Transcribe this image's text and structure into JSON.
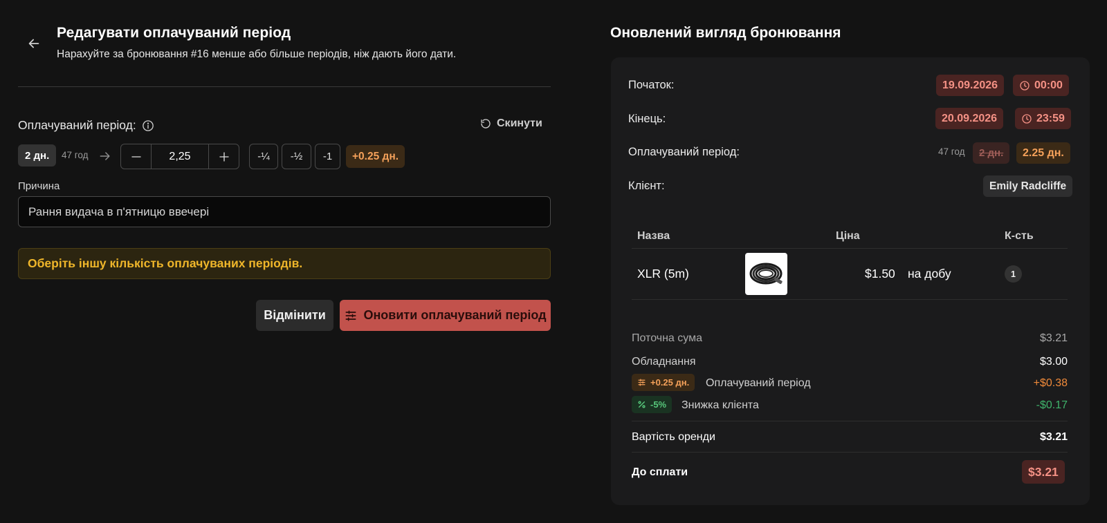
{
  "header": {
    "title": "Редагувати оплачуваний період",
    "subtitle": "Нарахуйте за бронювання #16 менше або більше періодів, ніж дають його дати."
  },
  "period": {
    "label": "Оплачуваний період:",
    "reset_label": "Скинути",
    "current_days": "2 дн.",
    "current_hours": "47 год",
    "stepper_value": "2,25",
    "quick": [
      "-¼",
      "-½",
      "-1"
    ],
    "delta_badge": "+0.25 дн."
  },
  "reason": {
    "label": "Причина",
    "value": "Рання видача в п'ятницю ввечері"
  },
  "warning": "Оберіть іншу кількість оплачуваних періодів.",
  "actions": {
    "cancel": "Відмінити",
    "update": "Оновити оплачуваний період"
  },
  "preview": {
    "title": "Оновлений вигляд бронювання",
    "start_label": "Початок:",
    "start_date": "19.09.2026",
    "start_time": "00:00",
    "end_label": "Кінець:",
    "end_date": "20.09.2026",
    "end_time": "23:59",
    "bp_label": "Оплачуваний період:",
    "bp_hours": "47 год",
    "bp_old": "2 дн.",
    "bp_new": "2.25 дн.",
    "client_label": "Клієнт:",
    "client_name": "Emily Radcliffe",
    "table": {
      "headers": {
        "name": "Назва",
        "price": "Ціна",
        "qty": "К-сть"
      },
      "items": [
        {
          "name": "XLR (5m)",
          "price": "$1.50",
          "unit": "на добу",
          "qty": "1"
        }
      ]
    },
    "summary": {
      "current_label": "Поточна сума",
      "current_value": "$3.21",
      "equipment_label": "Обладнання",
      "equipment_value": "$3.00",
      "adj_badge": "+0.25 дн.",
      "adj_label": "Оплачуваний період",
      "adj_value": "+$0.38",
      "discount_badge": "-5%",
      "discount_label": "Знижка клієнта",
      "discount_value": "-$0.17",
      "rent_label": "Вартість оренди",
      "rent_value": "$3.21",
      "due_label": "До сплати",
      "due_value": "$3.21"
    }
  },
  "colors": {
    "background": "#131313",
    "card": "#1b1b1c",
    "accent_red": "#c2524c",
    "warning_text": "#efb62a",
    "orange": "#f5a15a",
    "green": "#57c77b"
  }
}
